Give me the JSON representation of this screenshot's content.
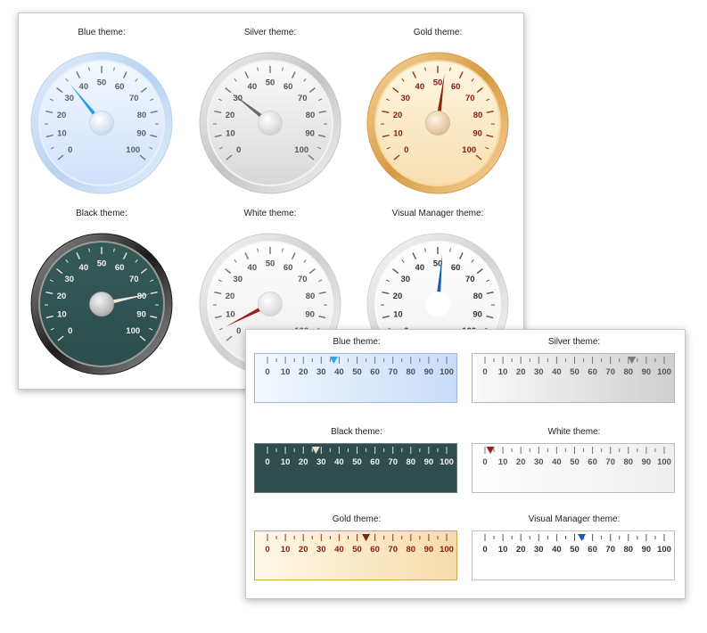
{
  "gauges": [
    {
      "id": "blue",
      "title": "Blue theme:",
      "value": 35,
      "colors": {
        "ring_outer": "#b8d2f0",
        "ring_inner": "#e6f0fc",
        "face_top": "#f4f8ff",
        "face_bottom": "#cfe0fa",
        "tick": "#6a7486",
        "label": "#5a6272",
        "needle": "#1ea0e0",
        "hub_light": "#ffffff",
        "hub_dark": "#c6d6ec"
      }
    },
    {
      "id": "silver",
      "title": "Silver theme:",
      "value": 30,
      "colors": {
        "ring_outer": "#c4c4c4",
        "ring_inner": "#f2f2f2",
        "face_top": "#fbfbfb",
        "face_bottom": "#d8d8d8",
        "tick": "#707070",
        "label": "#555555",
        "needle": "#6a6a6a",
        "hub_light": "#ffffff",
        "hub_dark": "#cfcfcf"
      }
    },
    {
      "id": "gold",
      "title": "Gold theme:",
      "value": 53,
      "colors": {
        "ring_outer": "#d69a44",
        "ring_inner": "#f7d8a0",
        "face_top": "#fff6e2",
        "face_bottom": "#f7dfb0",
        "tick": "#8b3a10",
        "label": "#8b1a10",
        "needle": "#8a2a10",
        "hub_light": "#fff6ea",
        "hub_dark": "#d9b98c"
      }
    },
    {
      "id": "black",
      "title": "Black theme:",
      "value": 80,
      "colors": {
        "ring_outer": "#1a1a1a",
        "ring_inner": "#9a9a9a",
        "face_top": "#345a58",
        "face_bottom": "#2b4d4c",
        "tick": "#e8e8e8",
        "label": "#f4f4f4",
        "needle": "#f0e8d8",
        "hub_light": "#f4f4f4",
        "hub_dark": "#a8a8a8"
      }
    },
    {
      "id": "white",
      "title": "White theme:",
      "value": 5,
      "colors": {
        "ring_outer": "#cfcfcf",
        "ring_inner": "#f7f7f7",
        "face_top": "#ffffff",
        "face_bottom": "#ececec",
        "tick": "#707070",
        "label": "#555555",
        "needle": "#9a1c20",
        "hub_light": "#ffffff",
        "hub_dark": "#d4d4d4"
      }
    },
    {
      "id": "visual",
      "title": "Visual Manager theme:",
      "value": 52,
      "colors": {
        "ring_outer": "#d2d2d2",
        "ring_inner": "#fafafa",
        "face_top": "#ffffff",
        "face_bottom": "#f2f2f2",
        "tick": "#555555",
        "label": "#333333",
        "needle": "#1a5ca8",
        "hub_light": "#ffffff",
        "hub_dark": "#ffffff"
      }
    }
  ],
  "scales": [
    {
      "id": "blue",
      "title": "Blue theme:",
      "value": 37,
      "colors": {
        "bg_left": "#f4f8ff",
        "bg_right": "#c8dcfa",
        "border": "#9fb6d6",
        "tick": "#6a7486",
        "label": "#4a5262",
        "marker": "#2aa6e2"
      }
    },
    {
      "id": "silver",
      "title": "Silver theme:",
      "value": 82,
      "colors": {
        "bg_left": "#fbfbfb",
        "bg_right": "#cfcfcf",
        "border": "#b4b4b4",
        "tick": "#707070",
        "label": "#555555",
        "marker": "#7a7a7a"
      }
    },
    {
      "id": "black",
      "title": "Black theme:",
      "value": 27,
      "colors": {
        "bg_left": "#2e4d4c",
        "bg_right": "#2e4d4c",
        "border": "#6a7a7a",
        "tick": "#e0e0e0",
        "label": "#f4f4f4",
        "marker": "#e8e0d0"
      }
    },
    {
      "id": "white",
      "title": "White theme:",
      "value": 3,
      "colors": {
        "bg_left": "#ffffff",
        "bg_right": "#eeeeee",
        "border": "#bdbdbd",
        "tick": "#707070",
        "label": "#555555",
        "marker": "#9a1c20"
      }
    },
    {
      "id": "gold",
      "title": "Gold theme:",
      "value": 55,
      "colors": {
        "bg_left": "#fff8e8",
        "bg_right": "#f6dcaa",
        "border": "#d2a650",
        "tick": "#8b3a10",
        "label": "#8b1a10",
        "marker": "#7a2a10"
      }
    },
    {
      "id": "visual",
      "title": "Visual Manager theme:",
      "value": 54,
      "colors": {
        "bg_left": "#ffffff",
        "bg_right": "#ffffff",
        "border": "#c0c0c0",
        "tick": "#555555",
        "label": "#333333",
        "marker": "#1a5ca8"
      }
    }
  ],
  "scale_labels": [
    "0",
    "10",
    "20",
    "30",
    "40",
    "50",
    "60",
    "70",
    "80",
    "90",
    "100"
  ]
}
